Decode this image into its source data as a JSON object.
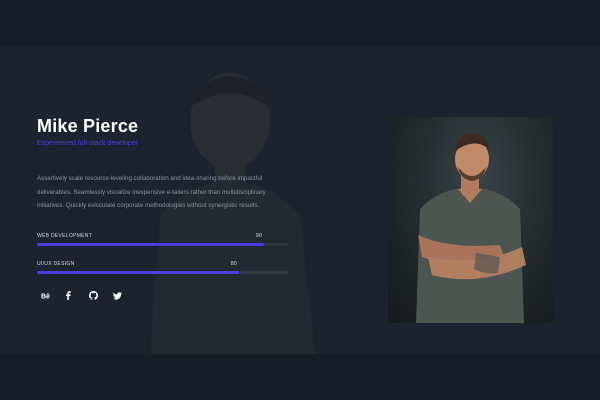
{
  "profile": {
    "name": "Mike Pierce",
    "role": "Experienced full-stack developer",
    "bio": "Assertively scale resource-leveling collaboration and idea-sharing before impactful deliverables. Seamlessly visualize inexpensive e-tailers rather than multidisciplinary initiatives. Quickly evisculate corporate methodologies without synergistic results."
  },
  "skills": [
    {
      "label": "WEB DEVELOPMENT",
      "value": "90",
      "percent": 90
    },
    {
      "label": "UI/UX DESIGN",
      "value": "80",
      "percent": 80
    }
  ],
  "socials": [
    {
      "name": "behance-icon",
      "glyph": "Bē"
    },
    {
      "name": "facebook-icon",
      "glyph": "f"
    },
    {
      "name": "github-icon",
      "glyph": ""
    },
    {
      "name": "twitter-icon",
      "glyph": ""
    }
  ],
  "colors": {
    "accent": "#4b3be0",
    "background": "#161b27",
    "panel": "#1c2230",
    "track": "#2e3442"
  }
}
